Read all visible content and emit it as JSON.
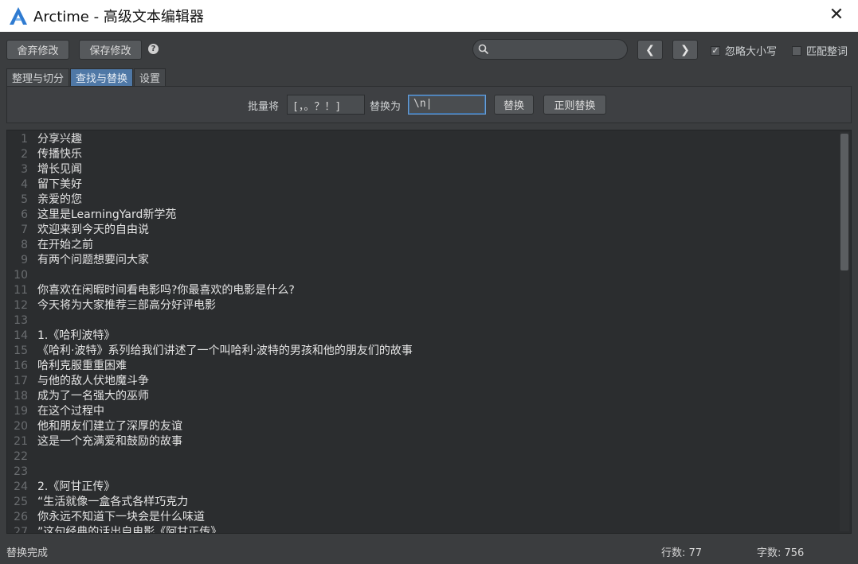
{
  "window": {
    "title": "Arctime - 高级文本编辑器",
    "close_glyph": "✕"
  },
  "toolbar": {
    "discard_label": "舍弃修改",
    "save_label": "保存修改",
    "help_glyph": "?",
    "search_value": "",
    "prev_glyph": "❮",
    "next_glyph": "❯",
    "ignore_case_label": "忽略大小写",
    "ignore_case_checked": true,
    "whole_word_label": "匹配整词",
    "whole_word_checked": false
  },
  "tabs": [
    {
      "label": "整理与切分",
      "active": false
    },
    {
      "label": "查找与替换",
      "active": true
    },
    {
      "label": "设置",
      "active": false
    }
  ],
  "replace": {
    "batch_label": "批量将",
    "find_value": "[，。？！]",
    "replace_with_label": "替换为",
    "replace_value": "\\n|",
    "replace_button": "替换",
    "regex_button": "正则替换"
  },
  "editor": {
    "lines": [
      {
        "n": "1",
        "text": "分享兴趣"
      },
      {
        "n": "2",
        "text": "传播快乐"
      },
      {
        "n": "3",
        "text": "增长见闻"
      },
      {
        "n": "4",
        "text": "留下美好"
      },
      {
        "n": "5",
        "text": "亲爱的您"
      },
      {
        "n": "6",
        "text": "这里是LearningYard新学苑"
      },
      {
        "n": "7",
        "text": "欢迎来到今天的自由说"
      },
      {
        "n": "8",
        "text": "在开始之前"
      },
      {
        "n": "9",
        "text": "有两个问题想要问大家"
      },
      {
        "n": "10",
        "text": ""
      },
      {
        "n": "11",
        "text": "你喜欢在闲暇时间看电影吗?你最喜欢的电影是什么?"
      },
      {
        "n": "12",
        "text": "今天将为大家推荐三部高分好评电影"
      },
      {
        "n": "13",
        "text": ""
      },
      {
        "n": "14",
        "text": "1.《哈利波特》"
      },
      {
        "n": "15",
        "text": "《哈利·波特》系列给我们讲述了一个叫哈利·波特的男孩和他的朋友们的故事"
      },
      {
        "n": "16",
        "text": "哈利克服重重困难"
      },
      {
        "n": "17",
        "text": "与他的敌人伏地魔斗争"
      },
      {
        "n": "18",
        "text": "成为了一名强大的巫师"
      },
      {
        "n": "19",
        "text": "在这个过程中"
      },
      {
        "n": "20",
        "text": "他和朋友们建立了深厚的友谊"
      },
      {
        "n": "21",
        "text": "这是一个充满爱和鼓励的故事"
      },
      {
        "n": "22",
        "text": ""
      },
      {
        "n": "23",
        "text": ""
      },
      {
        "n": "24",
        "text": "2.《阿甘正传》"
      },
      {
        "n": "25",
        "text": "“生活就像一盒各式各样巧克力"
      },
      {
        "n": "26",
        "text": "你永远不知道下一块会是什么味道"
      },
      {
        "n": "27",
        "text": "”这句经典的话出自电影《阿甘正传》"
      }
    ]
  },
  "status": {
    "message": "替换完成",
    "line_count": "行数: 77",
    "char_count": "字数: 756"
  },
  "colors": {
    "background": "#3b3d3f",
    "editor_bg": "#2b2d2f",
    "active_tab": "#4f78a6",
    "logo_blue": "#2f7bd1"
  }
}
